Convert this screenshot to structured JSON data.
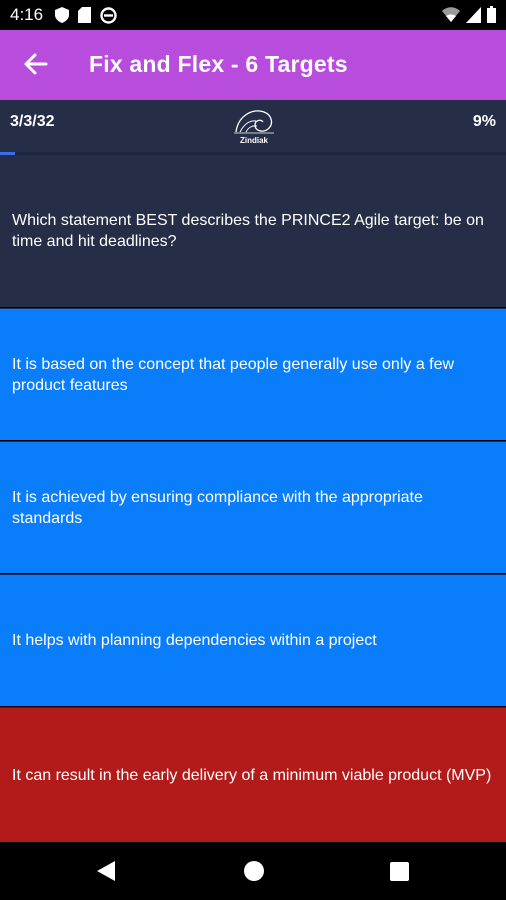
{
  "status_bar": {
    "time": "4:16",
    "icons_left": [
      "shield-icon",
      "sd-card-icon",
      "no-disturb-icon"
    ],
    "icons_right": [
      "wifi-icon",
      "signal-icon",
      "battery-icon"
    ]
  },
  "app_bar": {
    "title": "Fix and Flex - 6 Targets",
    "back_icon": "arrow-left-icon",
    "color": "#b84cdd"
  },
  "info_bar": {
    "progress_count": "3/3/32",
    "logo_text": "Zindiak",
    "progress_percent": "9%",
    "progress_fraction": 0.03
  },
  "question": {
    "text": "Which statement BEST describes the PRINCE2 Agile target: be on time and hit deadlines?"
  },
  "answers": [
    {
      "text": "It is based on the concept that people generally use only a few product features",
      "color": "#0a7dfa"
    },
    {
      "text": "It is achieved by ensuring compliance with the appropriate standards",
      "color": "#0a7dfa"
    },
    {
      "text": "It helps with planning dependencies within a project",
      "color": "#0a7dfa"
    },
    {
      "text": "It can result in the early delivery of a minimum viable product (MVP)",
      "color": "#b31b1b"
    }
  ],
  "nav_bar": {
    "icons": [
      "back-triangle-icon",
      "home-circle-icon",
      "recents-square-icon"
    ]
  }
}
